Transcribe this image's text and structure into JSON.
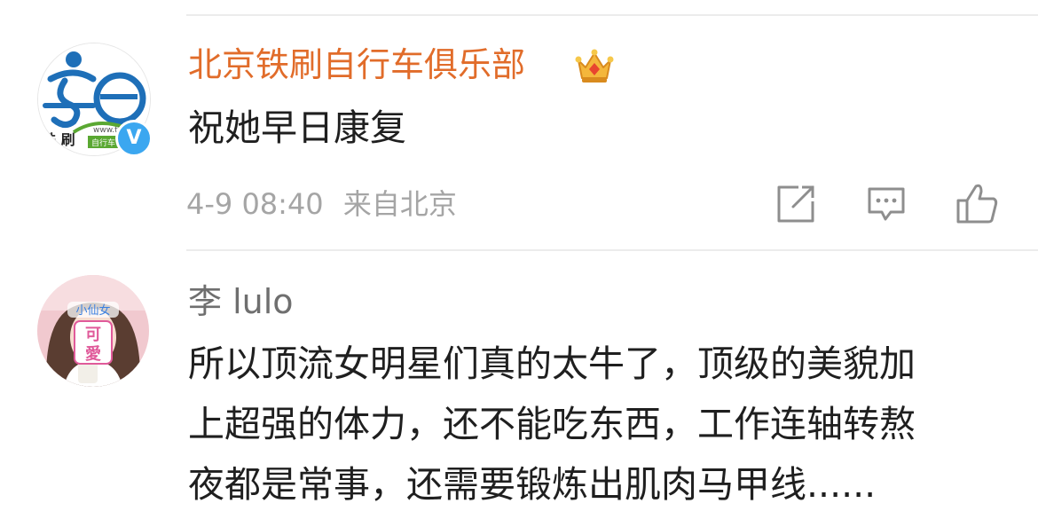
{
  "comments": [
    {
      "username": "北京铁刷自行车俱乐部",
      "text_lines": [
        "祝她早日康复"
      ],
      "time": "4-9 08:40",
      "source": "来自北京",
      "name_color": "#e16c2a",
      "verified_badge": "V",
      "avatar_logo_text": "铁 刷",
      "avatar_url_text": "www.tie",
      "avatar_sub_text": "自行车",
      "member_icon": "crown-icon",
      "actions": [
        "share-icon",
        "comment-icon",
        "like-icon"
      ]
    },
    {
      "username": "李 lulo",
      "text_lines": [
        "所以顶流女明星们真的太牛了，顶级的美貌加",
        "上超强的体力，还不能吃东西，工作连轴转熬",
        "夜都是常事，还需要锻炼出肌肉马甲线......"
      ],
      "avatar_sticker_top": "小仙女",
      "avatar_sticker_chars": [
        "可",
        "愛"
      ]
    }
  ],
  "colors": {
    "name_orange": "#e16c2a",
    "name_gray": "#6f6f6f",
    "meta_gray": "#a5a5a5",
    "text": "#1f1f1f",
    "icon_gray": "#8e8e8e"
  }
}
